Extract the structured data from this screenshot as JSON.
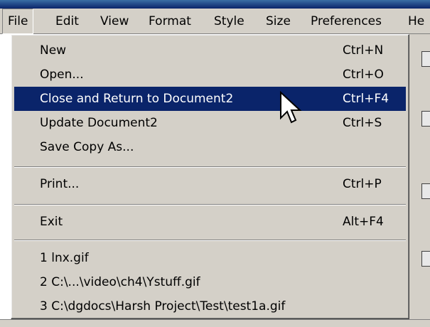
{
  "menubar": {
    "items": [
      {
        "label": "File",
        "active": true
      },
      {
        "label": "Edit"
      },
      {
        "label": "View"
      },
      {
        "label": "Format"
      },
      {
        "label": "Style"
      },
      {
        "label": "Size"
      },
      {
        "label": "Preferences"
      },
      {
        "label": "He"
      }
    ]
  },
  "file_menu": {
    "items": [
      {
        "label": "New",
        "shortcut": "Ctrl+N"
      },
      {
        "label": "Open...",
        "shortcut": "Ctrl+O"
      },
      {
        "label": "Close and Return to Document2",
        "shortcut": "Ctrl+F4",
        "highlighted": true
      },
      {
        "label": "Update Document2",
        "shortcut": "Ctrl+S"
      },
      {
        "label": "Save Copy As...",
        "shortcut": ""
      },
      {
        "label": "Print...",
        "shortcut": "Ctrl+P"
      },
      {
        "label": "Exit",
        "shortcut": "Alt+F4"
      },
      {
        "label": "1 lnx.gif"
      },
      {
        "label": "2 C:\\...\\video\\ch4\\Ystuff.gif"
      },
      {
        "label": "3 C:\\dgdocs\\Harsh Project\\Test\\test1a.gif"
      }
    ]
  },
  "colors": {
    "menu_bg": "#d4d0c8",
    "highlight_bg": "#0a246a",
    "highlight_text": "#ffffff"
  },
  "cursor_icon": "arrow-pointer-icon"
}
